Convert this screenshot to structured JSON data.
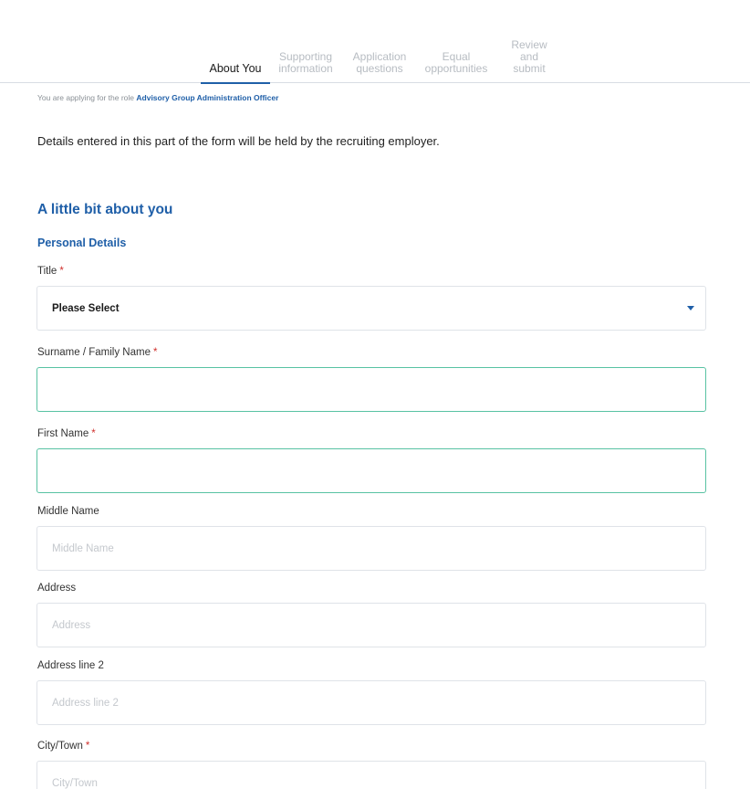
{
  "tabs": [
    {
      "lines": [
        "About You"
      ]
    },
    {
      "lines": [
        "Supporting",
        "information"
      ]
    },
    {
      "lines": [
        "Application",
        "questions"
      ]
    },
    {
      "lines": [
        "Equal",
        "opportunities"
      ]
    },
    {
      "lines": [
        "Review",
        "and",
        "submit"
      ]
    }
  ],
  "role": {
    "prefix": "You are applying for the role",
    "name": "Advisory Group Administration Officer"
  },
  "intro": "Details entered in this part of the form will be held by the recruiting employer.",
  "section_title": "A little bit about you",
  "subsection_title": "Personal Details",
  "required_marker": "*",
  "fields": {
    "title": {
      "label": "Title",
      "value": "Please Select"
    },
    "surname": {
      "label": "Surname / Family Name",
      "value": ""
    },
    "first_name": {
      "label": "First Name",
      "value": ""
    },
    "middle_name": {
      "label": "Middle Name",
      "placeholder": "Middle Name"
    },
    "address": {
      "label": "Address",
      "placeholder": "Address"
    },
    "address2": {
      "label": "Address line 2",
      "placeholder": "Address line 2"
    },
    "city": {
      "label": "City/Town",
      "placeholder": "City/Town"
    }
  },
  "colors": {
    "accent": "#1f5fa8",
    "required": "#d0312d",
    "focus_border": "#58c2a3"
  }
}
